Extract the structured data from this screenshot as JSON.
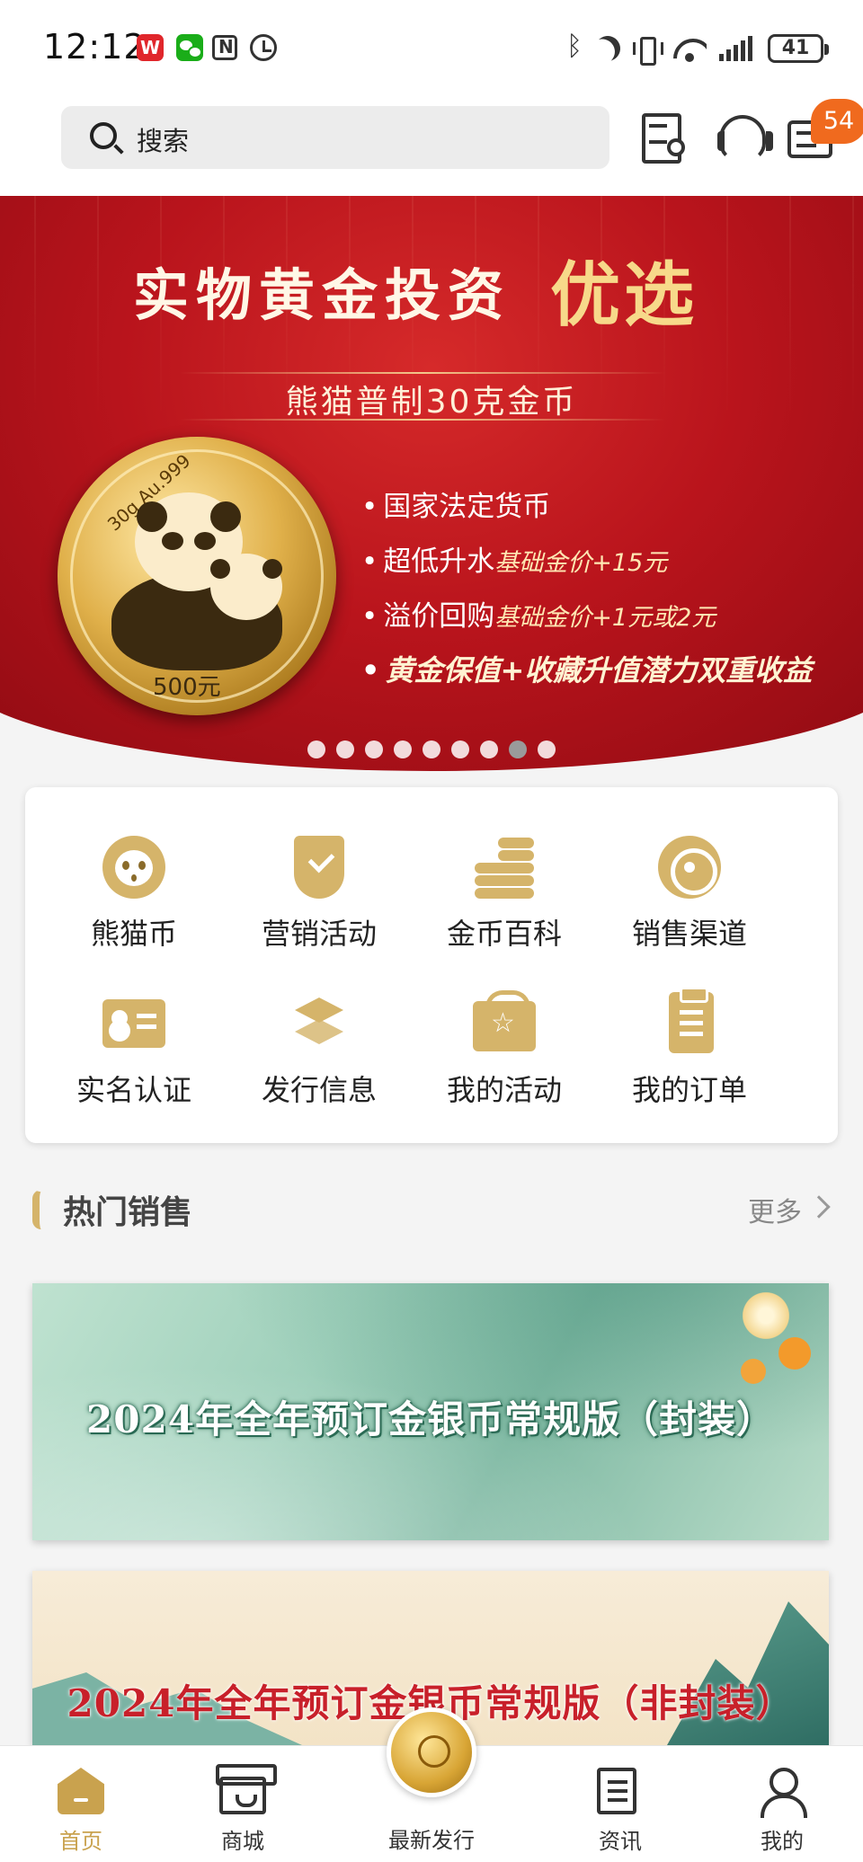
{
  "status_bar": {
    "time": "12:12",
    "app_badge": "W",
    "battery": "41"
  },
  "header": {
    "search_placeholder": "搜索",
    "message_badge": "54"
  },
  "banner": {
    "title": "实物黄金投资",
    "title_highlight": "优选",
    "subtitle": "熊猫普制30克金币",
    "coin_rim_text": "30g Au.999",
    "coin_denomination": "500元",
    "points": [
      {
        "text": "国家法定货币",
        "note": ""
      },
      {
        "text": "超低升水",
        "note": "基础金价+15元"
      },
      {
        "text": "溢价回购",
        "note": "基础金价+1元或2元"
      },
      {
        "text": "黄金保值+收藏升值潜力双重收益",
        "note": ""
      }
    ],
    "page_count": 9,
    "active_page": 8
  },
  "quick_entries": [
    {
      "label": "熊猫币",
      "icon": "panda-icon"
    },
    {
      "label": "营销活动",
      "icon": "shield-check-icon"
    },
    {
      "label": "金币百科",
      "icon": "coins-icon"
    },
    {
      "label": "销售渠道",
      "icon": "target-icon"
    },
    {
      "label": "实名认证",
      "icon": "id-card-icon"
    },
    {
      "label": "发行信息",
      "icon": "layers-icon"
    },
    {
      "label": "我的活动",
      "icon": "gift-icon"
    },
    {
      "label": "我的订单",
      "icon": "clipboard-icon"
    }
  ],
  "hot_sales": {
    "title": "热门销售",
    "more": "更多",
    "items": [
      {
        "title": "2024年全年预订金银币常规版（封装）"
      },
      {
        "title": "2024年全年预订金银币常规版（非封装）"
      }
    ]
  },
  "tabbar": {
    "tabs": [
      {
        "label": "首页",
        "icon": "home-icon",
        "active": true
      },
      {
        "label": "商城",
        "icon": "shop-icon",
        "active": false
      },
      {
        "label": "最新发行",
        "icon": "coin-icon",
        "active": false
      },
      {
        "label": "资讯",
        "icon": "news-icon",
        "active": false
      },
      {
        "label": "我的",
        "icon": "user-icon",
        "active": false
      }
    ]
  },
  "colors": {
    "accent_gold": "#c9a24e",
    "badge_orange": "#f06a1e",
    "banner_red": "#b9141c"
  }
}
